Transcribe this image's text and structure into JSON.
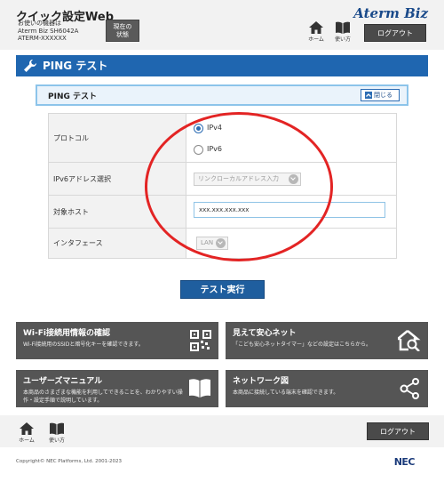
{
  "header": {
    "app_title": "クイック設定Web",
    "device_line1": "お使いの機器は",
    "device_line2": "Aterm Biz SH6042A",
    "device_line3": "ATERM-XXXXXX",
    "status_button_line1": "現在の",
    "status_button_line2": "状態",
    "brand": "Aterm Biz",
    "home_label": "ホーム",
    "help_label": "使い方",
    "logout_label": "ログアウト"
  },
  "page": {
    "title": "PING テスト"
  },
  "section": {
    "title": "PING テスト",
    "close_label": "閉じる"
  },
  "form": {
    "protocol_label": "プロトコル",
    "protocol_options": [
      "IPv4",
      "IPv6"
    ],
    "protocol_selected": "IPv4",
    "ipv6_select_label": "IPv6アドレス選択",
    "ipv6_select_value": "リンクローカルアドレス入力",
    "target_host_label": "対象ホスト",
    "target_host_value": "xxx.xxx.xxx.xxx",
    "interface_label": "インタフェース",
    "interface_value": "LAN"
  },
  "run_button": "テスト実行",
  "tiles": [
    {
      "title": "Wi-Fi接続用情報の確認",
      "desc": "Wi-Fi接続用のSSIDと暗号化キーを確認できます。",
      "icon": "qr-code-icon"
    },
    {
      "title": "見えて安心ネット",
      "desc": "「こども安心ネットタイマー」などの設定はこちらから。",
      "icon": "house-search-icon"
    },
    {
      "title": "ユーザーズマニュアル",
      "desc": "本商品のさまざまな機能を利用してできることを、わかりやすい操作・設定手順で説明しています。",
      "icon": "book-icon"
    },
    {
      "title": "ネットワーク図",
      "desc": "本商品に接続している端末を確認できます。",
      "icon": "network-icon"
    }
  ],
  "footer": {
    "home_label": "ホーム",
    "help_label": "使い方",
    "logout_label": "ログアウト",
    "copyright": "Copyright© NEC Platforms, Ltd. 2001-2023",
    "logo": "NEC"
  },
  "colors": {
    "accent_blue": "#1f66b0",
    "annotation_red": "#e32424",
    "tile_gray": "#555555"
  }
}
